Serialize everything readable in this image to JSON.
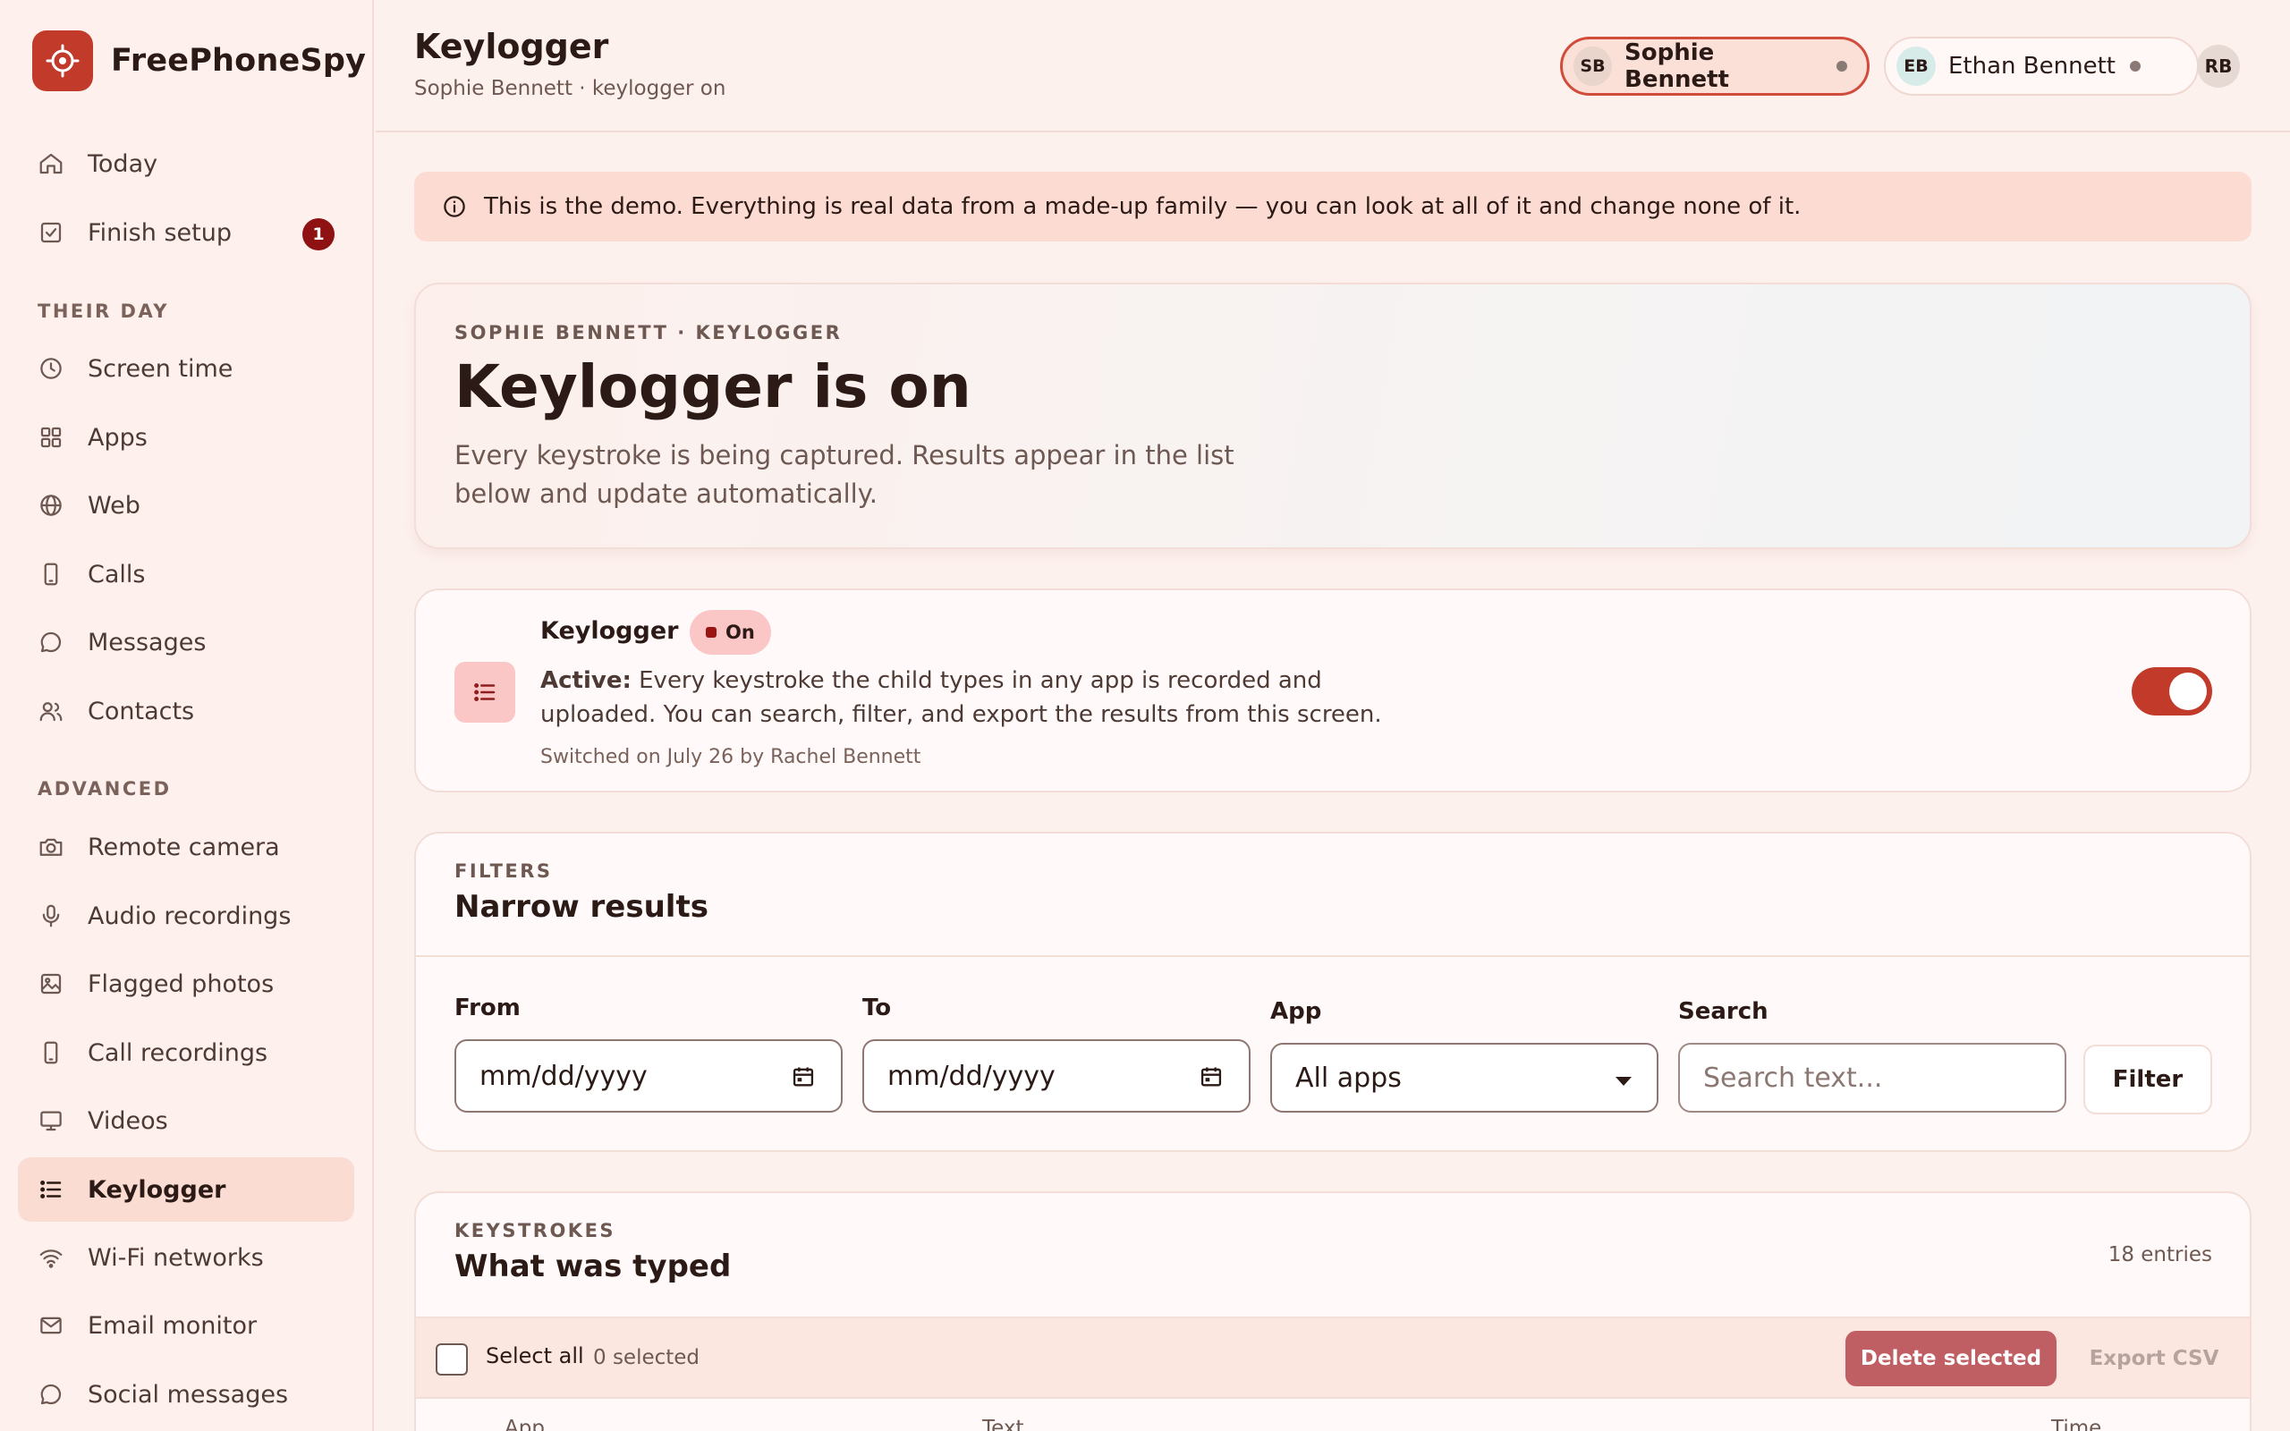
{
  "brand": {
    "name": "FreePhoneSpy"
  },
  "sidebar": {
    "top": [
      {
        "label": "Today",
        "icon": "home-icon"
      },
      {
        "label": "Finish setup",
        "icon": "checkbox-icon",
        "badge": "1"
      }
    ],
    "section_day": "THEIR DAY",
    "day": [
      {
        "label": "Screen time",
        "icon": "clock-icon"
      },
      {
        "label": "Apps",
        "icon": "grid-icon"
      },
      {
        "label": "Web",
        "icon": "globe-icon"
      },
      {
        "label": "Calls",
        "icon": "phone-icon"
      },
      {
        "label": "Messages",
        "icon": "chat-bubble-icon"
      },
      {
        "label": "Contacts",
        "icon": "people-icon"
      }
    ],
    "section_advanced": "ADVANCED",
    "advanced": [
      {
        "label": "Remote camera",
        "icon": "camera-icon"
      },
      {
        "label": "Audio recordings",
        "icon": "microphone-icon"
      },
      {
        "label": "Flagged photos",
        "icon": "image-icon"
      },
      {
        "label": "Call recordings",
        "icon": "phone-icon"
      },
      {
        "label": "Videos",
        "icon": "monitor-icon"
      },
      {
        "label": "Keylogger",
        "icon": "list-icon",
        "active": true
      },
      {
        "label": "Wi-Fi networks",
        "icon": "wifi-icon"
      },
      {
        "label": "Email monitor",
        "icon": "mail-icon"
      },
      {
        "label": "Social messages",
        "icon": "chat-bubble-icon"
      }
    ]
  },
  "header": {
    "title": "Keylogger",
    "subtitle": "Sophie Bennett · keylogger on",
    "profiles": [
      {
        "initials": "SB",
        "name": "Sophie Bennett"
      },
      {
        "initials": "EB",
        "name": "Ethan Bennett"
      }
    ],
    "account_initials": "RB"
  },
  "banner": {
    "text": "This is the demo. Everything is real data from a made-up family — you can look at all of it and change none of it."
  },
  "hero": {
    "eyebrow": "SOPHIE BENNETT · KEYLOGGER",
    "title": "Keylogger is on",
    "description": "Every keystroke is being captured. Results appear in the list below and update automatically."
  },
  "feature": {
    "title": "Keylogger",
    "status": "On",
    "active_label": "Active:",
    "description": "Every keystroke the child types in any app is recorded and uploaded. You can search, filter, and export the results from this screen.",
    "meta": "Switched on July 26 by Rachel Bennett",
    "enabled": true
  },
  "filters": {
    "eyebrow": "FILTERS",
    "title": "Narrow results",
    "from_label": "From",
    "from_value": "mm/dd/yyyy",
    "to_label": "To",
    "to_value": "mm/dd/yyyy",
    "app_label": "App",
    "app_value": "All apps",
    "search_label": "Search",
    "search_placeholder": "Search text...",
    "button": "Filter"
  },
  "keystrokes": {
    "eyebrow": "KEYSTROKES",
    "title": "What was typed",
    "count": "18 entries",
    "select_all": "Select all",
    "selected": "0 selected",
    "delete": "Delete selected",
    "export": "Export CSV",
    "columns": [
      "App",
      "Text",
      "Time"
    ]
  },
  "colors": {
    "accent": "#c23b2a",
    "badge": "#8e1212",
    "banner": "#fcdcd2",
    "active_nav": "#fbdcd2"
  }
}
